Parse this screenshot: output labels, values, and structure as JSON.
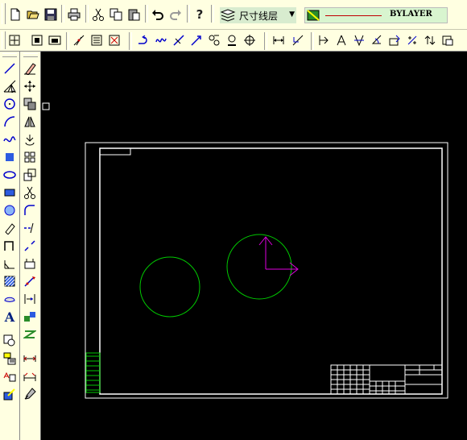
{
  "toolbar": {
    "layer": {
      "name": "尺寸线层"
    },
    "color": {
      "label": "BYLAYER"
    }
  },
  "colors": {
    "toolbar_bg": "#FFFFE1",
    "canvas_bg": "#000000",
    "border_lines": "#FFFFFF",
    "circles": "#00C800",
    "ucs_icon": "#E000E0",
    "title_block": "#FFFFFF",
    "linetype_sample": "#C00000"
  },
  "icons": {
    "standard": [
      "new-icon",
      "open-icon",
      "save-icon",
      "print-icon",
      "cut-icon",
      "copy-icon",
      "paste-icon",
      "undo-icon",
      "redo-icon",
      "help-icon"
    ],
    "layer": [
      "layers-icon",
      "layer-state-icon"
    ],
    "object_snap": [
      "snap-tracking-icon",
      "snap-endpoint-icon",
      "snap-midpoint-icon",
      "snap-intersection-icon",
      "snap-apparent-icon",
      "snap-extension-icon",
      "snap-center-icon",
      "snap-quadrant-icon",
      "snap-tangent-icon",
      "snap-perpendicular-icon",
      "snap-parallel-icon",
      "snap-node-icon",
      "snap-nearest-icon",
      "snap-none-icon",
      "snap-settings-icon"
    ],
    "dimension": [
      "linear-dim-icon",
      "aligned-dim-icon",
      "ordinate-dim-icon",
      "radius-dim-icon",
      "diameter-dim-icon",
      "angular-dim-icon",
      "baseline-dim-icon",
      "continue-dim-icon",
      "leader-icon",
      "tolerance-icon",
      "center-mark-icon",
      "dim-edit-icon"
    ],
    "draw": [
      "line-icon",
      "construction-line-icon",
      "circle-icon",
      "arc-icon",
      "spline-icon",
      "point-icon",
      "ellipse-icon",
      "rectangle-icon",
      "polygon-icon",
      "revision-cloud-icon",
      "polyline-icon",
      "table-icon",
      "hatch-icon",
      "region-icon",
      "text-icon",
      "insert-block-icon",
      "make-block-icon",
      "attribute-icon",
      "block-editor-icon"
    ],
    "modify": [
      "erase-icon",
      "move-icon",
      "copy-object-icon",
      "mirror-icon",
      "rotate-icon",
      "array-icon",
      "scale-icon",
      "trim-icon",
      "fillet-icon",
      "extend-icon",
      "break-icon",
      "explode-icon",
      "stretch-icon",
      "chamfer-icon",
      "join-icon",
      "offset-icon",
      "measure-icon",
      "divide-icon",
      "match-properties-icon"
    ]
  }
}
